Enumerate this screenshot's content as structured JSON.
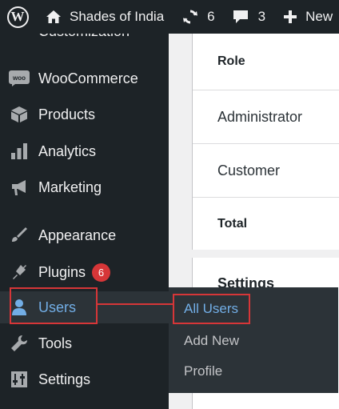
{
  "adminbar": {
    "site_name": "Shades of India",
    "updates_count": "6",
    "comments_count": "3",
    "new_label": "New"
  },
  "sidebar": {
    "partial_label": "Customization",
    "items": [
      {
        "label": "WooCommerce",
        "icon": "woo-icon"
      },
      {
        "label": "Products",
        "icon": "box-icon"
      },
      {
        "label": "Analytics",
        "icon": "bar-chart-icon"
      },
      {
        "label": "Marketing",
        "icon": "megaphone-icon"
      },
      {
        "label": "Appearance",
        "icon": "paintbrush-icon"
      },
      {
        "label": "Plugins",
        "icon": "plug-icon",
        "badge": "6"
      },
      {
        "label": "Users",
        "icon": "user-icon"
      },
      {
        "label": "Tools",
        "icon": "wrench-icon"
      },
      {
        "label": "Settings",
        "icon": "settings-icon"
      }
    ]
  },
  "users_submenu": {
    "items": [
      "All Users",
      "Add New",
      "Profile"
    ]
  },
  "table": {
    "header": "Role",
    "rows": [
      "Administrator",
      "Customer"
    ],
    "footer": "Total"
  },
  "settings_panel": {
    "title": "Settings"
  },
  "colors": {
    "sidebar_bg": "#1d2327",
    "active_text": "#72aee6",
    "highlight": "#d63638",
    "badge": "#d63638"
  }
}
